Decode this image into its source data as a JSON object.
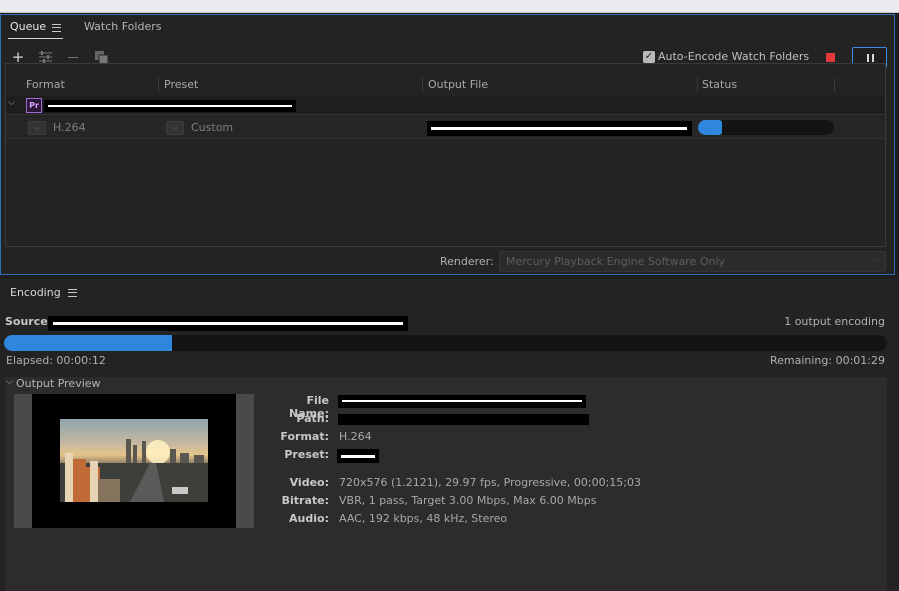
{
  "queue_panel": {
    "tabs": [
      {
        "label": "Queue",
        "active": true
      },
      {
        "label": "Watch Folders",
        "active": false
      }
    ],
    "toolbar": {
      "add_icon": "plus-icon",
      "settings_icon": "sliders-icon",
      "remove_icon": "minus-icon",
      "duplicate_icon": "duplicate-icon"
    },
    "auto_encode": {
      "label": "Auto-Encode Watch Folders",
      "checked": true
    },
    "stop_color": "#e03a3a",
    "columns": [
      "Format",
      "Preset",
      "Output File",
      "Status"
    ],
    "group_row": {
      "app_badge": "Pr"
    },
    "item_row": {
      "format": "H.264",
      "preset": "Custom",
      "status_progress": 0.18
    },
    "renderer": {
      "label": "Renderer:",
      "value": "Mercury Playback Engine Software Only"
    }
  },
  "encoding_panel": {
    "title": "Encoding",
    "source_label": "Source:",
    "output_count": "1 output encoding",
    "progress": 0.19,
    "elapsed": "Elapsed: 00:00:12",
    "remaining": "Remaining: 00:01:29",
    "preview_section": "Output Preview",
    "details": {
      "file_name_label": "File Name:",
      "path_label": "Path:",
      "format_label": "Format:",
      "format_value": "H.264",
      "preset_label": "Preset:",
      "video_label": "Video:",
      "video_value": "720x576 (1.2121), 29.97 fps, Progressive, 00;00;15;03",
      "bitrate_label": "Bitrate:",
      "bitrate_value": "VBR, 1 pass, Target 3.00 Mbps, Max 6.00 Mbps",
      "audio_label": "Audio:",
      "audio_value": "AAC, 192 kbps, 48 kHz, Stereo"
    }
  },
  "colors": {
    "accent": "#2e87dd",
    "panel": "#232323",
    "focus_border": "#2d6fb8"
  }
}
